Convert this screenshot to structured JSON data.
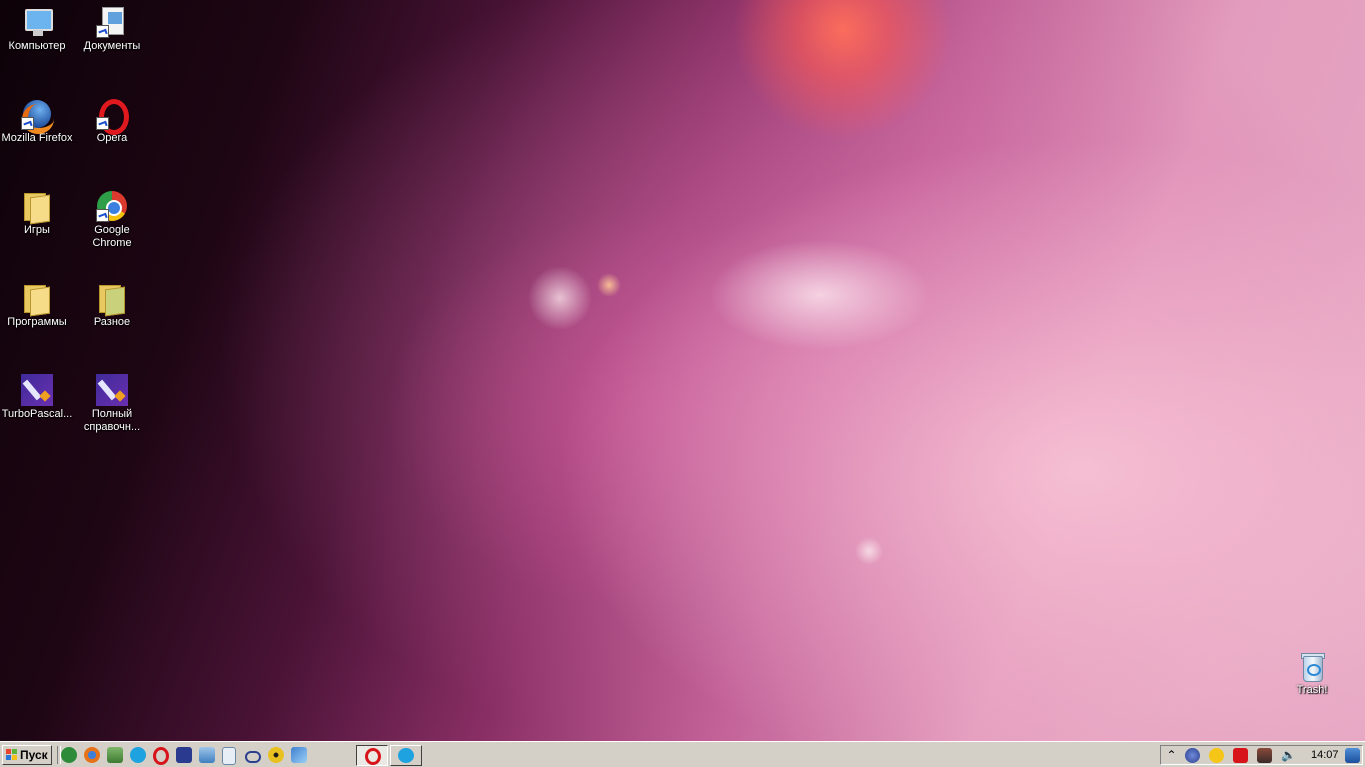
{
  "desktop": {
    "icons": {
      "computer": "Компьютер",
      "documents": "Документы",
      "firefox": "Mozilla Firefox",
      "opera": "Opera",
      "games": "Игры",
      "chrome": "Google Chrome",
      "programs": "Программы",
      "misc": "Разное",
      "turbopascal": "TurboPascal...",
      "reference": "Полный справочн...",
      "trash": "Trash!"
    }
  },
  "taskbar": {
    "start_label": "Пуск",
    "quick_launch": [
      "utorrent-icon",
      "firefox-icon",
      "installer-icon",
      "skype-icon",
      "opera-icon",
      "save-icon",
      "network-icon",
      "calculator-icon",
      "link-icon",
      "radiation-icon",
      "tool-icon"
    ],
    "tasks": [
      "opera-icon",
      "skype-icon"
    ],
    "tray": [
      "show-hidden-icon",
      "power-icon",
      "notes-icon",
      "antivirus-icon",
      "device-icon",
      "volume-icon"
    ],
    "clock": "14:07"
  }
}
